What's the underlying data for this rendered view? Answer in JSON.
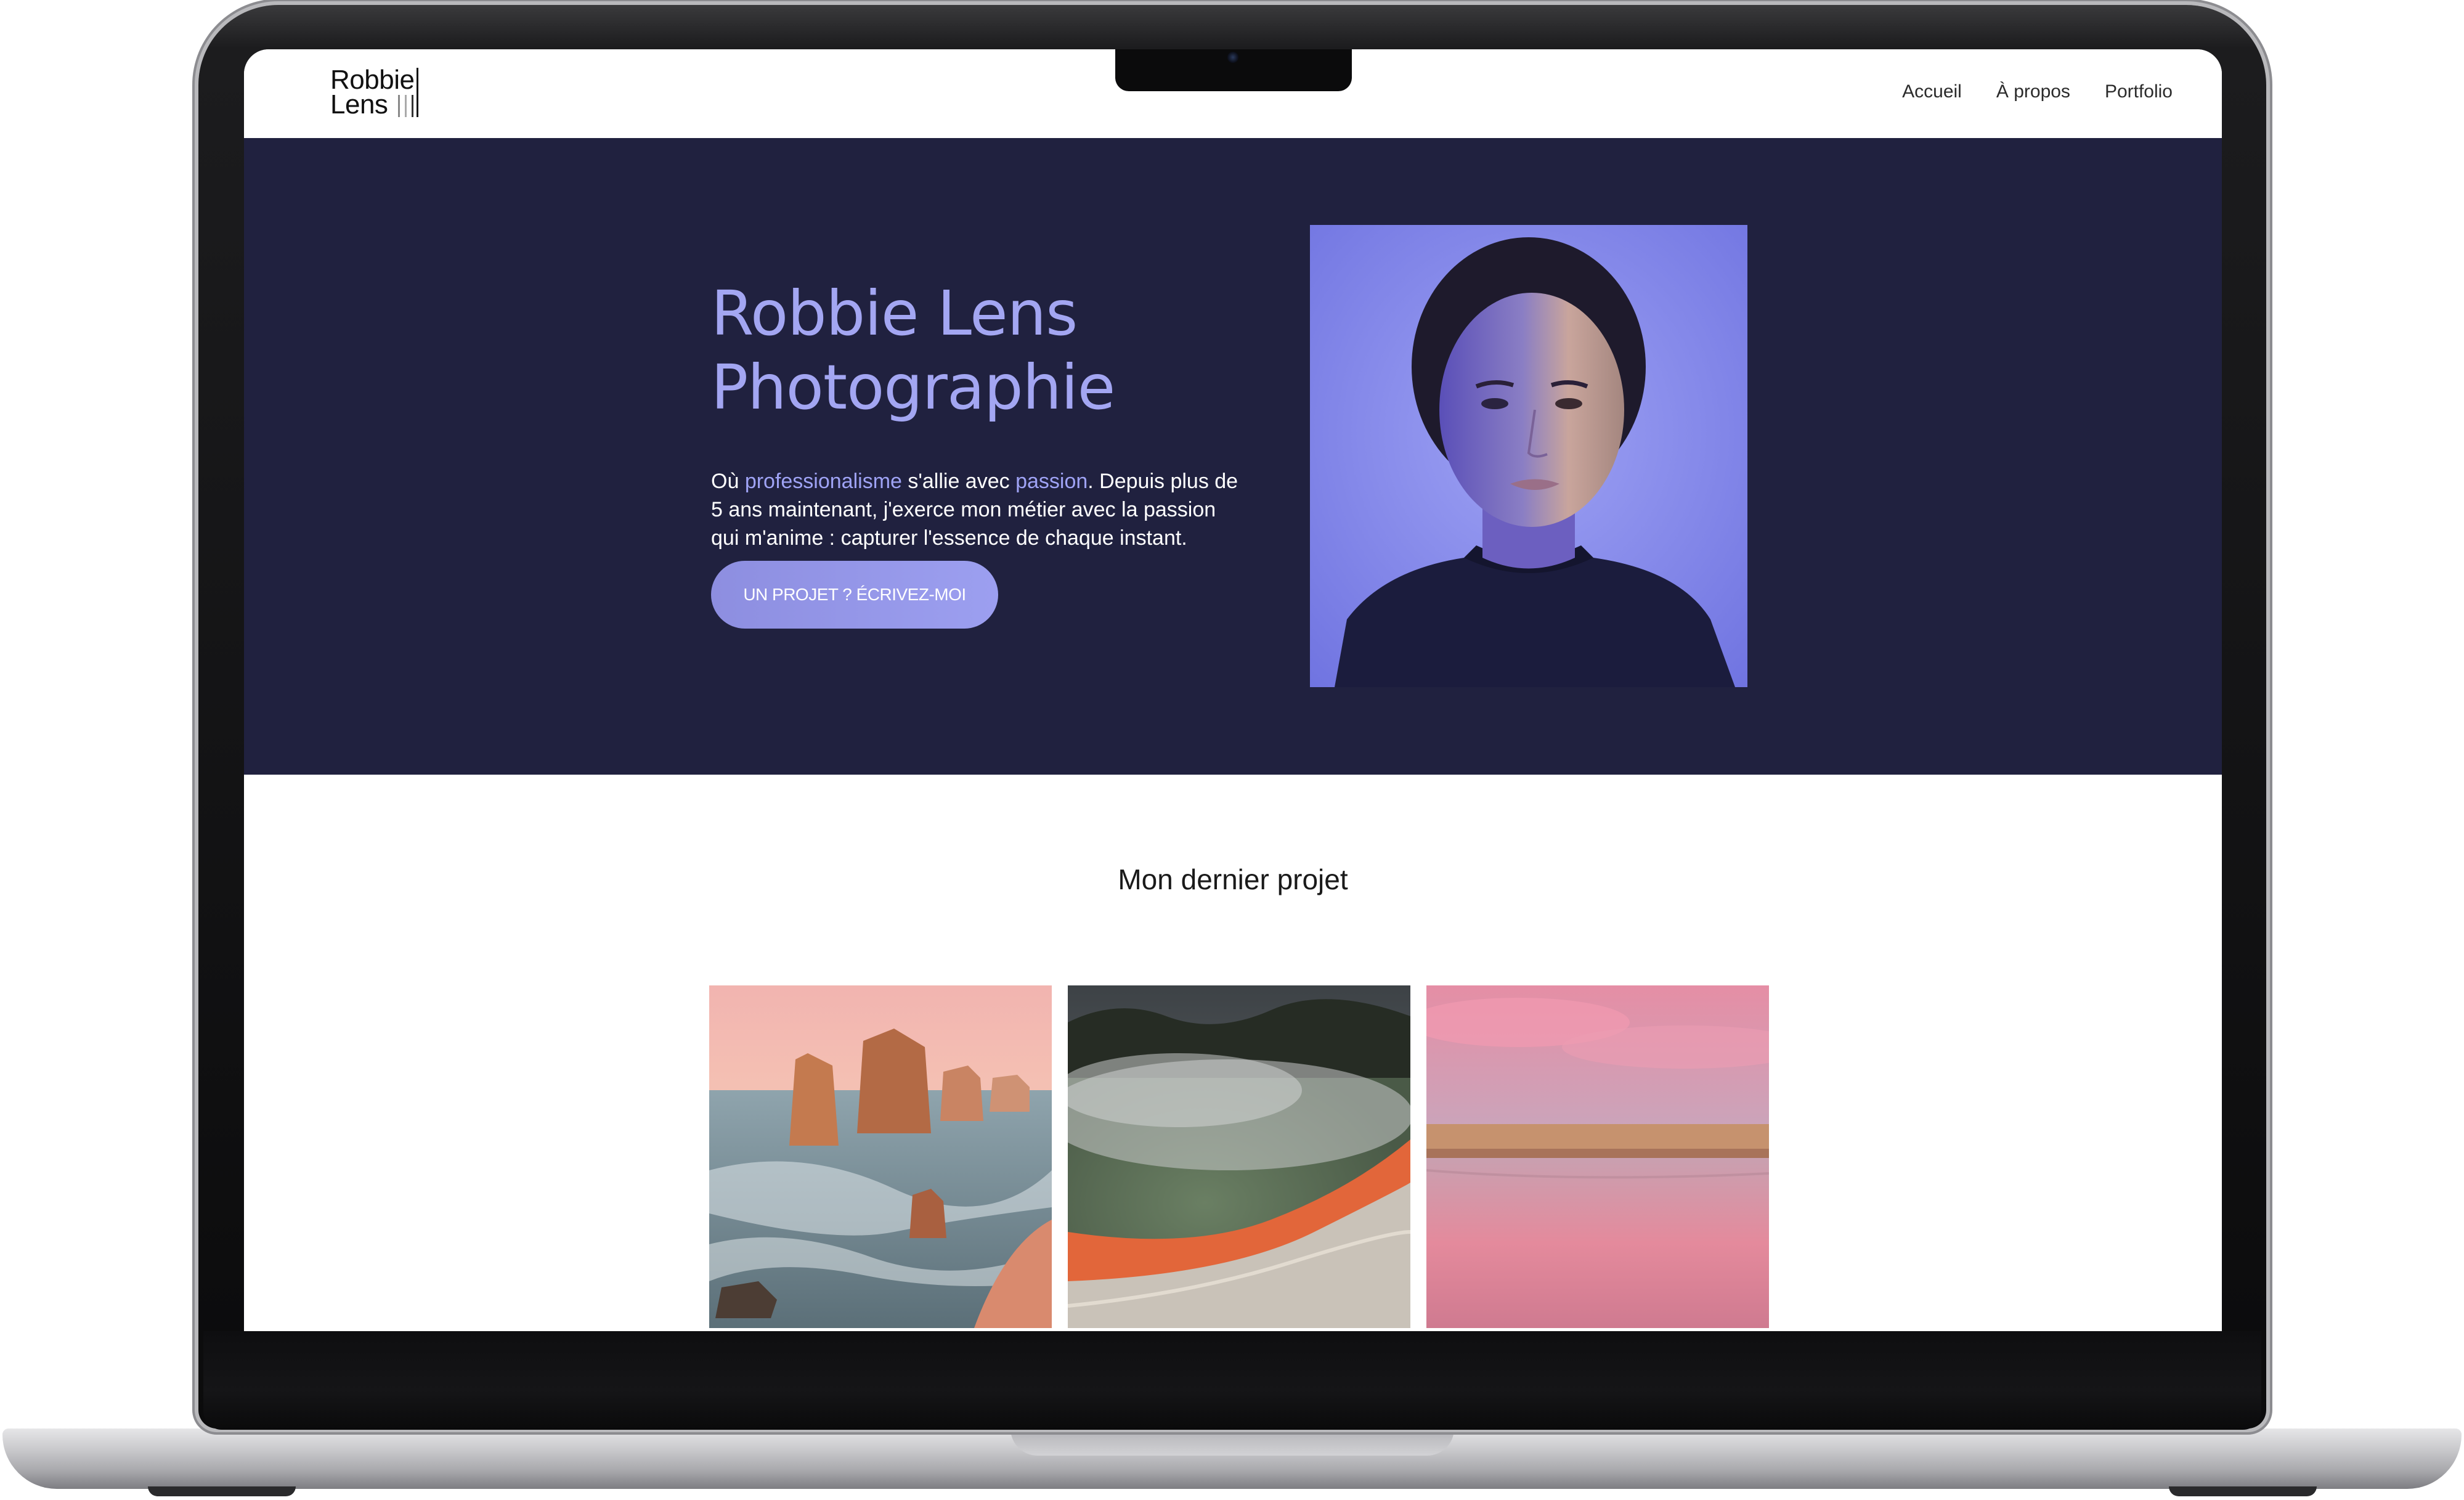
{
  "site": {
    "logo": {
      "line1": "Robbie",
      "line2": "Lens"
    },
    "nav": [
      {
        "label": "Accueil"
      },
      {
        "label": "À propos"
      },
      {
        "label": "Portfolio"
      }
    ]
  },
  "hero": {
    "title_line1": "Robbie Lens",
    "title_line2": "Photographie",
    "text_part1": "Où ",
    "text_accent1": "professionalisme",
    "text_part2": " s'allie avec ",
    "text_accent2": "passion",
    "text_part3": ". Depuis plus de 5 ans maintenant, j'exerce mon métier avec la passion qui m'anime : capturer l'essence de chaque instant.",
    "cta_label": "UN PROJET ? ÉCRIVEZ-MOI",
    "portrait_alt": "portrait"
  },
  "project": {
    "title": "Mon dernier projet",
    "photos": [
      {
        "name": "coastal-rocks"
      },
      {
        "name": "hot-spring"
      },
      {
        "name": "pink-beach"
      }
    ]
  },
  "colors": {
    "hero_bg": "#20213f",
    "accent": "#a3a6f2",
    "cta": "#9c9ff0"
  }
}
